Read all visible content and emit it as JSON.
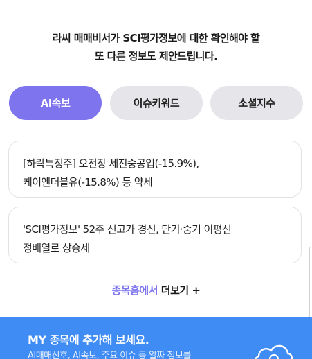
{
  "prompt": {
    "line1": "라씨 매매비서가 SCI평가정보에 대한 확인해야 할",
    "line2": "또 다른 정보도 제안드립니다."
  },
  "tabs": [
    {
      "label": "AI속보",
      "active": true
    },
    {
      "label": "이슈키워드",
      "active": false
    },
    {
      "label": "소셜지수",
      "active": false
    }
  ],
  "news": [
    {
      "line1": "[하락특징주] 오전장 세진중공업(-15.9%),",
      "line2": "케이엔더블유(-15.8%) 등 약세"
    },
    {
      "line1": "'SCI평가정보' 52주 신고가 경신, 단기·중기 이평선",
      "line2": "정배열로 상승세"
    }
  ],
  "more": {
    "prefix": "종목홈에서",
    "label": "더보기 +"
  },
  "banner": {
    "title": "MY 종목에 추가해 보세요.",
    "subtitle": "AI매매신호, AI속보, 주요 이슈 등 알짜 정보를"
  },
  "colors": {
    "accent": "#7d74ee",
    "tab_inactive": "#e6e6ea",
    "banner": "#3f8cf5"
  },
  "icons": {
    "banner_icon": "cloud-icon"
  }
}
